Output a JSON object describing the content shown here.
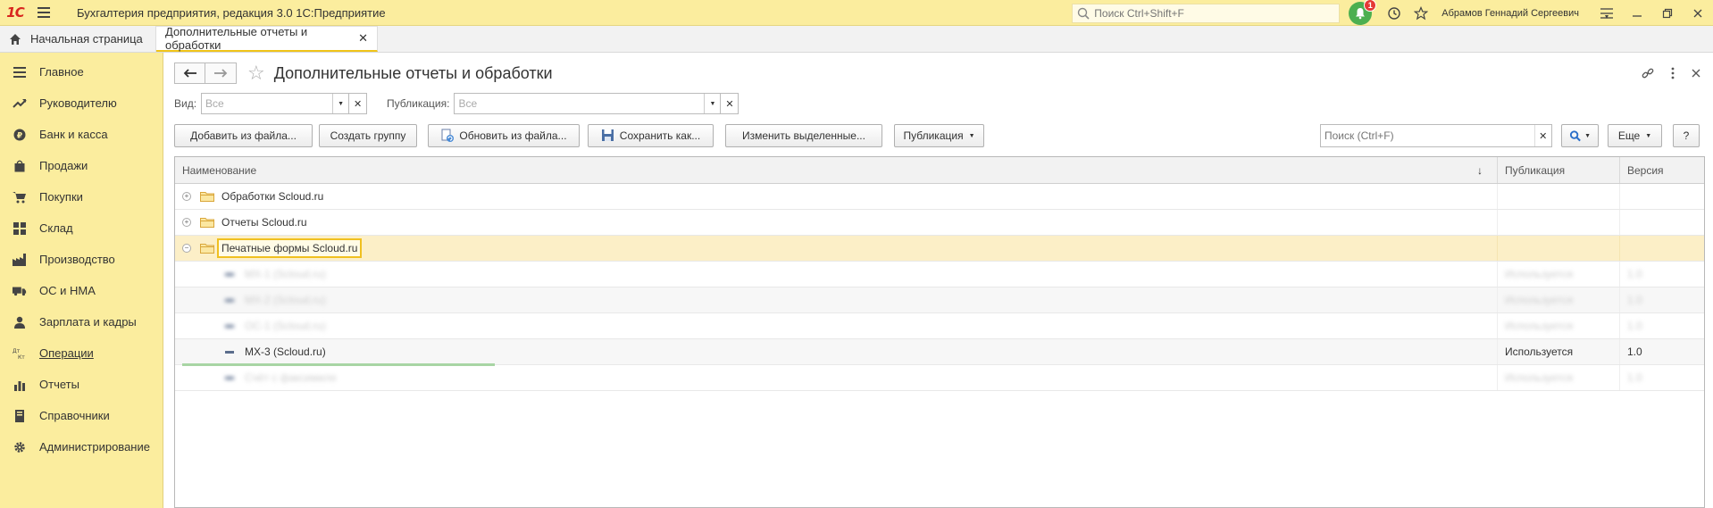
{
  "titlebar": {
    "logo_text": "1С",
    "app_title": "Бухгалтерия предприятия, редакция 3.0 1С:Предприятие",
    "search_placeholder": "Поиск Ctrl+Shift+F",
    "notification_count": "1",
    "user_name": "Абрамов Геннадий Сергеевич"
  },
  "tabs": [
    {
      "label": "Начальная страница"
    },
    {
      "label": "Дополнительные отчеты и обработки"
    }
  ],
  "sidebar": {
    "items": [
      {
        "label": "Главное",
        "icon": "menu-lines-icon"
      },
      {
        "label": "Руководителю",
        "icon": "trend-up-icon"
      },
      {
        "label": "Банк и касса",
        "icon": "ruble-coin-icon"
      },
      {
        "label": "Продажи",
        "icon": "shopping-bag-icon"
      },
      {
        "label": "Покупки",
        "icon": "cart-icon"
      },
      {
        "label": "Склад",
        "icon": "warehouse-icon"
      },
      {
        "label": "Производство",
        "icon": "factory-icon"
      },
      {
        "label": "ОС и НМА",
        "icon": "truck-icon"
      },
      {
        "label": "Зарплата и кадры",
        "icon": "person-icon"
      },
      {
        "label": "Операции",
        "icon": "dt-kt-icon"
      },
      {
        "label": "Отчеты",
        "icon": "bar-chart-icon"
      },
      {
        "label": "Справочники",
        "icon": "books-icon"
      },
      {
        "label": "Администрирование",
        "icon": "gear-icon"
      }
    ]
  },
  "page": {
    "title": "Дополнительные отчеты и обработки"
  },
  "filters": {
    "kind_label": "Вид:",
    "kind_value": "Все",
    "publication_label": "Публикация:",
    "publication_value": "Все"
  },
  "commands": {
    "add_from_file": "Добавить из файла...",
    "create_group": "Создать группу",
    "update_from_file": "Обновить из файла...",
    "save_as": "Сохранить как...",
    "change_selected": "Изменить выделенные...",
    "publication": "Публикация",
    "search_placeholder": "Поиск (Ctrl+F)",
    "more": "Еще",
    "help": "?"
  },
  "grid": {
    "columns": [
      "Наименование",
      "Публикация",
      "Версия"
    ],
    "rows": [
      {
        "name": "Обработки Scloud.ru",
        "publication": "",
        "version": "",
        "type": "folder",
        "expander": "+"
      },
      {
        "name": "Отчеты Scloud.ru",
        "publication": "",
        "version": "",
        "type": "folder",
        "expander": "+"
      },
      {
        "name": "Печатные формы Scloud.ru",
        "publication": "",
        "version": "",
        "type": "folder",
        "expander": "−",
        "selected": true
      },
      {
        "name": "МХ-1 (Scloud.ru)",
        "publication": "Используется",
        "version": "1.0",
        "type": "item",
        "blurred": true
      },
      {
        "name": "МХ-2 (Scloud.ru)",
        "publication": "Используется",
        "version": "1.0",
        "type": "item",
        "blurred": true
      },
      {
        "name": "ОС-1 (Scloud.ru)",
        "publication": "Используется",
        "version": "1.0",
        "type": "item",
        "blurred": true
      },
      {
        "name": "МХ-3 (Scloud.ru)",
        "publication": "Используется",
        "version": "1.0",
        "type": "item"
      },
      {
        "name": "Счёт с факсимиле",
        "publication": "Используется",
        "version": "1.0",
        "type": "item",
        "blurred": true
      }
    ]
  }
}
